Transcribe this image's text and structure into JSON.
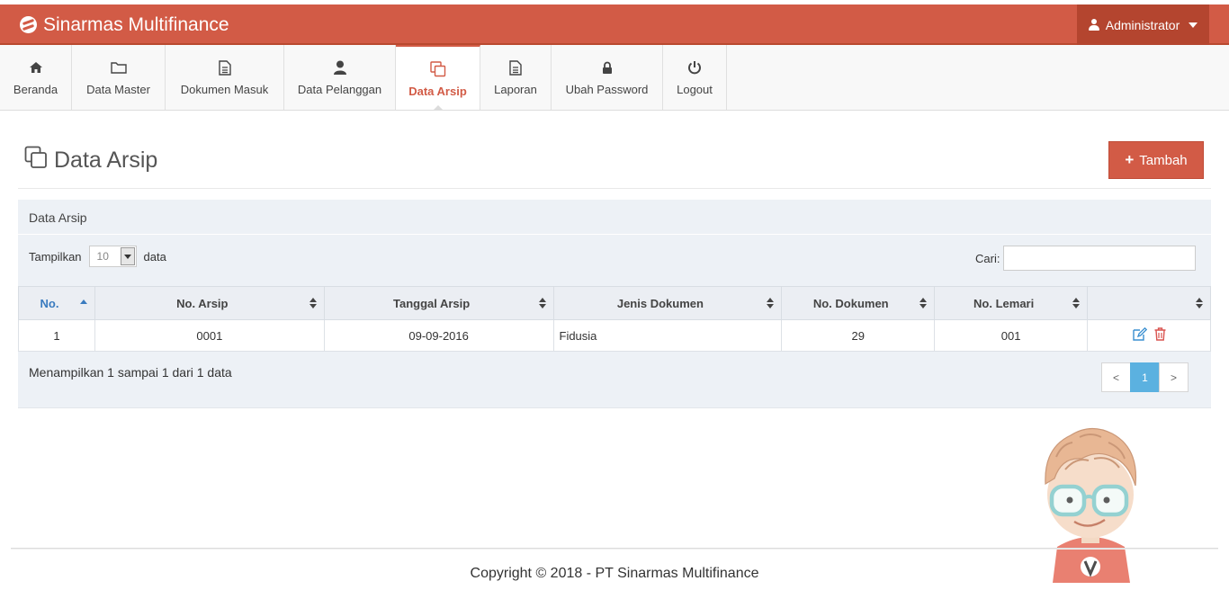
{
  "brand": {
    "name": "Sinarmas Multifinance"
  },
  "user_menu": {
    "label": "Administrator"
  },
  "menu": [
    {
      "label": "Beranda",
      "icon": "home-icon"
    },
    {
      "label": "Data Master",
      "icon": "folder-icon"
    },
    {
      "label": "Dokumen Masuk",
      "icon": "document-icon"
    },
    {
      "label": "Data Pelanggan",
      "icon": "user-icon"
    },
    {
      "label": "Data Arsip",
      "icon": "copy-icon",
      "active": true
    },
    {
      "label": "Laporan",
      "icon": "document-icon"
    },
    {
      "label": "Ubah Password",
      "icon": "lock-icon"
    },
    {
      "label": "Logout",
      "icon": "power-icon"
    }
  ],
  "page": {
    "title": "Data Arsip",
    "add_button": "Tambah"
  },
  "panel": {
    "title": "Data Arsip",
    "length_prefix": "Tampilkan",
    "length_value": "10",
    "length_suffix": "data",
    "search_label": "Cari:",
    "search_value": ""
  },
  "table": {
    "columns": [
      "No.",
      "No. Arsip",
      "Tanggal Arsip",
      "Jenis Dokumen",
      "No. Dokumen",
      "No. Lemari",
      ""
    ],
    "rows": [
      {
        "no": "1",
        "no_arsip": "0001",
        "tanggal_arsip": "09-09-2016",
        "jenis_dokumen": "Fidusia",
        "no_dokumen": "29",
        "no_lemari": "001"
      }
    ]
  },
  "info": "Menampilkan 1 sampai 1 dari 1 data",
  "pagination": {
    "prev": "<",
    "current": "1",
    "next": ">"
  },
  "footer": "Copyright © 2018 - PT Sinarmas Multifinance",
  "colors": {
    "brand": "#d25b46",
    "active_page": "#5bb1e0",
    "edit": "#3a8fd0",
    "delete": "#d9534f"
  }
}
